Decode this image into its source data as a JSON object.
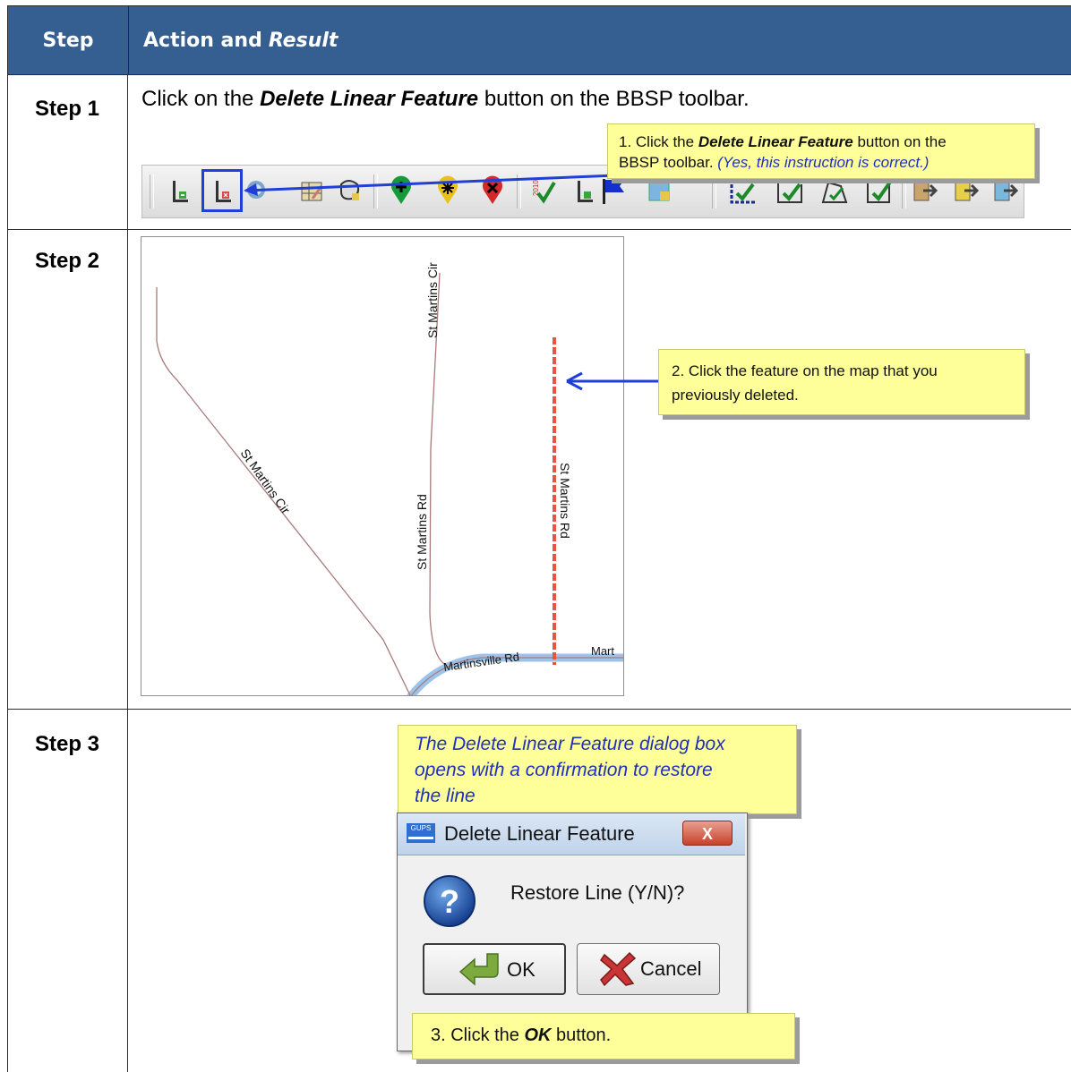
{
  "header": {
    "step_col": "Step",
    "action_col": "Action and",
    "action_col_italic": "Result"
  },
  "steps": [
    {
      "label": "Step 1"
    },
    {
      "label": "Step 2"
    },
    {
      "label": "Step 3"
    }
  ],
  "step1": {
    "instruction_pre": "Click on the ",
    "instruction_bold": "Delete Linear Feature",
    "instruction_post": " button on the BBSP toolbar.",
    "callout_line1_pre": "1. Click the ",
    "callout_line1_bold": "Delete Linear Feature",
    "callout_line1_post": " button on the",
    "callout_line2_pre": "BBSP toolbar. ",
    "callout_line2_italic": "(Yes, this instruction is correct.)",
    "toolbar_icons": [
      "add-line-icon",
      "delete-line-icon",
      "zoom-icon",
      "table-edit-icon",
      "polygon-tool-icon",
      "add-point-icon",
      "edit-point-icon",
      "delete-point-icon",
      "validate-2010-icon",
      "line-flag-icon",
      "flag-icon",
      "map-tool-icon",
      "check-edit-1-icon",
      "check-edit-2-icon",
      "check-edit-3-icon",
      "check-edit-4-icon",
      "export-1-icon",
      "export-2-icon",
      "export-3-icon"
    ]
  },
  "step2": {
    "callout_line1": "2. Click the feature on the map that you",
    "callout_line2": "previously deleted.",
    "map_labels": {
      "road1": "St Martins Cir",
      "road2": "St Martins Cir",
      "road3": "St Martins Rd",
      "road4": "St Martins Rd",
      "road5": "Martinsville Rd",
      "road6": "Mart"
    }
  },
  "step3": {
    "callout_line1": "The Delete Linear Feature dialog box",
    "callout_line2": "opens with  a confirmation to restore",
    "callout_line3": "the line",
    "dialog_app_icon": "GUPS",
    "dialog_title": "Delete Linear Feature",
    "dialog_close": "X",
    "dialog_message": "Restore Line (Y/N)?",
    "ok_label": "OK",
    "cancel_label": "Cancel",
    "callout_bottom_pre": "3. Click the ",
    "callout_bottom_bold": "OK",
    "callout_bottom_post": " button."
  },
  "colors": {
    "header_bg": "#365f91",
    "callout_bg": "#ffff99",
    "highlight": "#1f3fd6",
    "deleted_line": "#e8553f",
    "road": "#a87a7a",
    "major_road": "#9cc3ea"
  }
}
